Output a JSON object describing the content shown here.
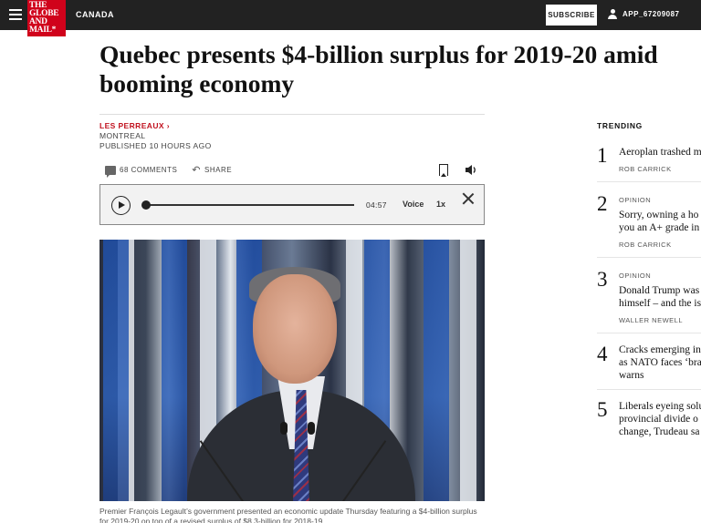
{
  "header": {
    "logo_lines": [
      "THE",
      "GLOBE",
      "AND",
      "MAIL*"
    ],
    "section": "CANADA",
    "subscribe_label": "SUBSCRIBE",
    "username": "APP_67209087"
  },
  "article": {
    "headline": "Quebec presents $4-billion surplus for 2019-20 amid booming economy",
    "author": "LES PERREAUX",
    "dateline": "MONTREAL",
    "published": "PUBLISHED 10 HOURS AGO",
    "comments_label": "68 COMMENTS",
    "share_label": "SHARE",
    "caption": "Premier François Legault’s government presented an economic update Thursday featuring a $4-billion surplus for 2019-20 on top of a revised surplus of $8.3-billion for 2018-19."
  },
  "player": {
    "duration": "04:57",
    "voice_label": "Voice",
    "speed_label": "1x",
    "progress": 0
  },
  "trending": {
    "heading": "TRENDING",
    "items": [
      {
        "num": "1",
        "label": "",
        "title_lines": [
          "Aeroplan trashed m"
        ],
        "byline": "ROB CARRICK"
      },
      {
        "num": "2",
        "label": "OPINION",
        "title_lines": [
          "Sorry, owning a ho",
          "you an A+ grade in"
        ],
        "byline": "ROB CARRICK"
      },
      {
        "num": "3",
        "label": "OPINION",
        "title_lines": [
          "Donald Trump was",
          "himself – and the is"
        ],
        "byline": "WALLER NEWELL"
      },
      {
        "num": "4",
        "label": "",
        "title_lines": [
          "Cracks emerging in",
          "as NATO faces ‘bra",
          "warns"
        ],
        "byline": ""
      },
      {
        "num": "5",
        "label": "",
        "title_lines": [
          "Liberals eyeing solu",
          "provincial divide o",
          "change, Trudeau sa"
        ],
        "byline": ""
      }
    ]
  },
  "colors": {
    "topbar": "#222222",
    "brand_red": "#d0021b",
    "author_red": "#c1121f"
  }
}
